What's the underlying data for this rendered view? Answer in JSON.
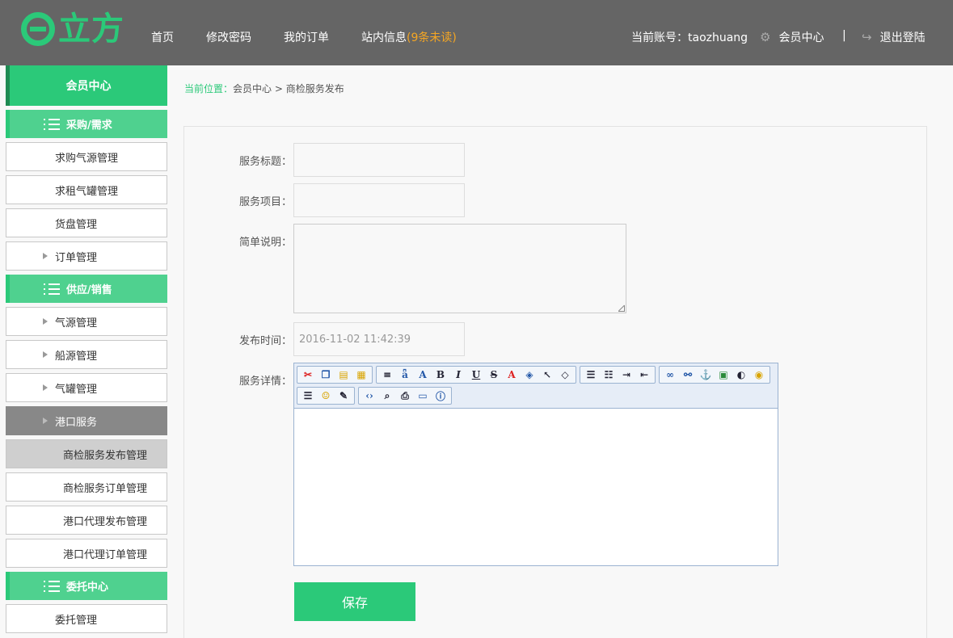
{
  "header": {
    "logo_text": "立方",
    "nav": [
      {
        "label": "首页"
      },
      {
        "label": "修改密码"
      },
      {
        "label": "我的订单"
      },
      {
        "label": "站内信息",
        "badge": "(9条未读)"
      }
    ],
    "account_label": "当前账号：",
    "account_name": "taozhuang",
    "member_center": "会员中心",
    "divider": "|",
    "logout": "退出登陆"
  },
  "sidebar": {
    "title": "会员中心",
    "groups": [
      {
        "label": "采购/需求",
        "items": [
          "求购气源管理",
          "求租气罐管理",
          "货盘管理",
          "订单管理"
        ]
      },
      {
        "label": "供应/销售",
        "items": [
          "气源管理",
          "船源管理",
          "气罐管理",
          "港口服务"
        ],
        "sub_items": [
          "商检服务发布管理",
          "商检服务订单管理",
          "港口代理发布管理",
          "港口代理订单管理"
        ]
      },
      {
        "label": "委托中心",
        "items": [
          "委托管理"
        ]
      }
    ]
  },
  "breadcrumb": {
    "lead": "当前位置：",
    "path": "会员中心 > 商检服务发布"
  },
  "form": {
    "title_label": "服务标题：",
    "item_label": "服务项目：",
    "desc_label": "简单说明：",
    "time_label": "发布时间：",
    "time_value": "2016-11-02 11:42:39",
    "detail_label": "服务详情：",
    "save": "保存"
  },
  "editor_toolbar": {
    "row1": [
      [
        "cut-icon",
        "copy-icon",
        "paste-icon",
        "paste-text-icon"
      ],
      [
        "line-height-icon",
        "spellcheck-icon",
        "font-size-icon",
        "bold-icon",
        "italic-icon",
        "underline-icon",
        "strikethrough-icon",
        "font-color-icon",
        "bg-color-icon",
        "select-icon",
        "eraser-icon"
      ],
      [
        "align-icon",
        "list-icon",
        "indent-icon",
        "outdent-icon"
      ],
      [
        "link-icon",
        "unlink-icon",
        "anchor-icon",
        "image-icon",
        "flash-icon",
        "media-icon"
      ]
    ],
    "row2": [
      [
        "hr-icon",
        "emoticon-icon",
        "edit-icon"
      ],
      [
        "source-icon",
        "preview-icon",
        "print-icon",
        "fullscreen-icon",
        "about-icon"
      ]
    ]
  }
}
